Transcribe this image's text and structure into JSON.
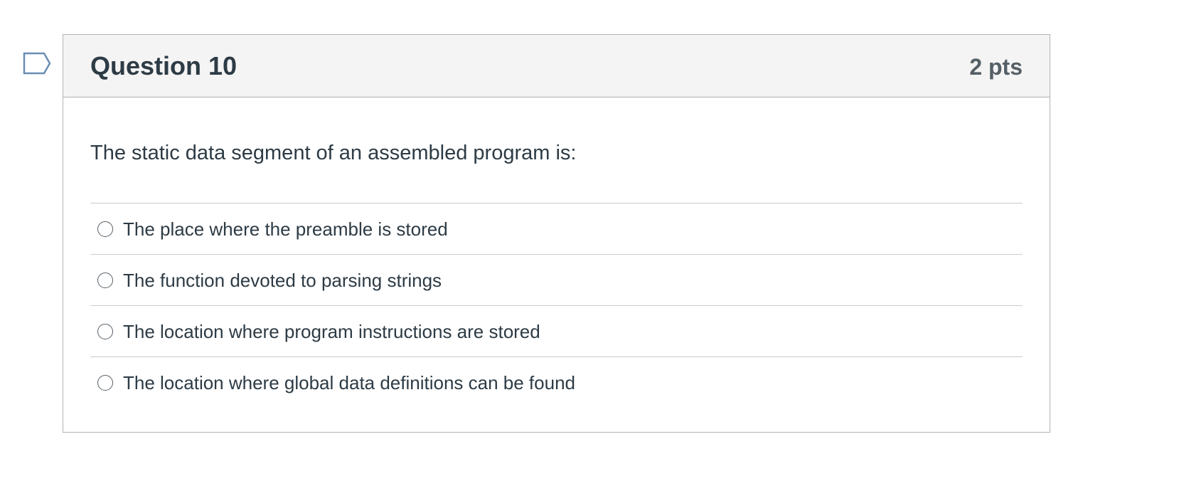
{
  "question": {
    "title": "Question 10",
    "points": "2 pts",
    "text": "The static data segment of an assembled program is:",
    "flag_icon": "flag-question-icon",
    "answers": [
      {
        "label": "The place where the preamble is stored",
        "selected": false
      },
      {
        "label": "The function devoted to parsing strings",
        "selected": false
      },
      {
        "label": "The location where program instructions are stored",
        "selected": false
      },
      {
        "label": "The location where global data definitions can be found",
        "selected": false
      }
    ]
  },
  "colors": {
    "header_bg": "#f4f4f4",
    "border": "#b3b3b3",
    "text": "#2d3b45",
    "points_text": "#555f66",
    "flag_stroke": "#6b8db5"
  }
}
